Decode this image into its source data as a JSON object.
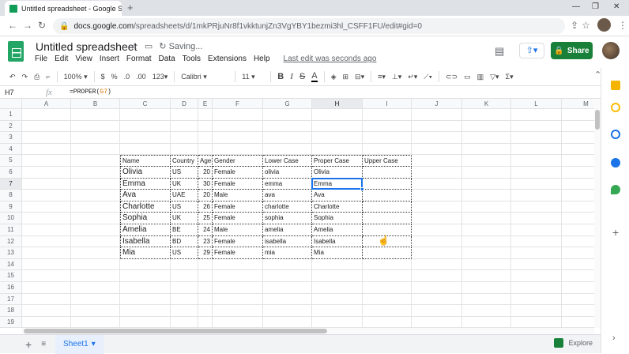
{
  "browser": {
    "tab_title": "Untitled spreadsheet - Google Sh",
    "tab_close": "×",
    "new_tab": "+",
    "window_minimize": "—",
    "window_restore": "❐",
    "window_close": "✕",
    "back": "←",
    "forward": "→",
    "reload": "↻",
    "url_host": "docs.google.com",
    "url_path": "/spreadsheets/d/1mkPRjuNr8f1vkktunjZn3VgYBY1bezmi3hl_CSFF1FU/edit#gid=0"
  },
  "header": {
    "doc_title": "Untitled spreadsheet",
    "saving": "Saving...",
    "menus": [
      "File",
      "Edit",
      "View",
      "Insert",
      "Format",
      "Data",
      "Tools",
      "Extensions",
      "Help"
    ],
    "last_edit": "Last edit was seconds ago",
    "share_label": "Share"
  },
  "toolbar": {
    "zoom": "100%",
    "currency": "$",
    "percent": "%",
    "dec_decrease": ".0",
    "dec_increase": ".00",
    "more_formats": "123",
    "font": "Calibri",
    "font_size": "11",
    "bold": "B",
    "italic": "I",
    "strike": "S",
    "text_color": "A"
  },
  "formula_bar": {
    "cell_ref": "H7",
    "fx": "fx",
    "formula_pre": "=PROPER(",
    "formula_ref": "G7",
    "formula_post": ")"
  },
  "grid": {
    "columns": [
      "A",
      "B",
      "C",
      "D",
      "E",
      "F",
      "G",
      "H",
      "I",
      "J",
      "K",
      "L",
      "M"
    ],
    "rows": [
      "1",
      "2",
      "3",
      "4",
      "5",
      "6",
      "7",
      "8",
      "9",
      "10",
      "11",
      "12",
      "13",
      "14",
      "15",
      "16",
      "17",
      "18",
      "19",
      "20"
    ],
    "selected_cell": "H7",
    "table": {
      "headers": [
        "Name",
        "Country",
        "Age",
        "Gender",
        "Lower Case",
        "Proper Case",
        "Upper Case"
      ],
      "rows": [
        [
          "Olivia",
          "US",
          "20",
          "Female",
          "olivia",
          "Olivia",
          ""
        ],
        [
          "Emma",
          "UK",
          "30",
          "Female",
          "emma",
          "Emma",
          ""
        ],
        [
          "Ava",
          "UAE",
          "20",
          "Male",
          "ava",
          "Ava",
          ""
        ],
        [
          "Charlotte",
          "US",
          "26",
          "Female",
          "charlotte",
          "Charlotte",
          ""
        ],
        [
          "Sophia",
          "UK",
          "25",
          "Female",
          "sophia",
          "Sophia",
          ""
        ],
        [
          "Amelia",
          "BE",
          "24",
          "Male",
          "amelia",
          "Amelia",
          ""
        ],
        [
          "Isabella",
          "BD",
          "23",
          "Female",
          "isabella",
          "Isabella",
          ""
        ],
        [
          "Mia",
          "US",
          "29",
          "Female",
          "mia",
          "Mia",
          ""
        ]
      ]
    }
  },
  "bottom": {
    "add_sheet": "+",
    "all_sheets": "≡",
    "sheet_tab": "Sheet1",
    "explore": "Explore"
  },
  "colors": {
    "accent": "#1a73e8",
    "share": "#188038",
    "sheets_green": "#23a566"
  }
}
